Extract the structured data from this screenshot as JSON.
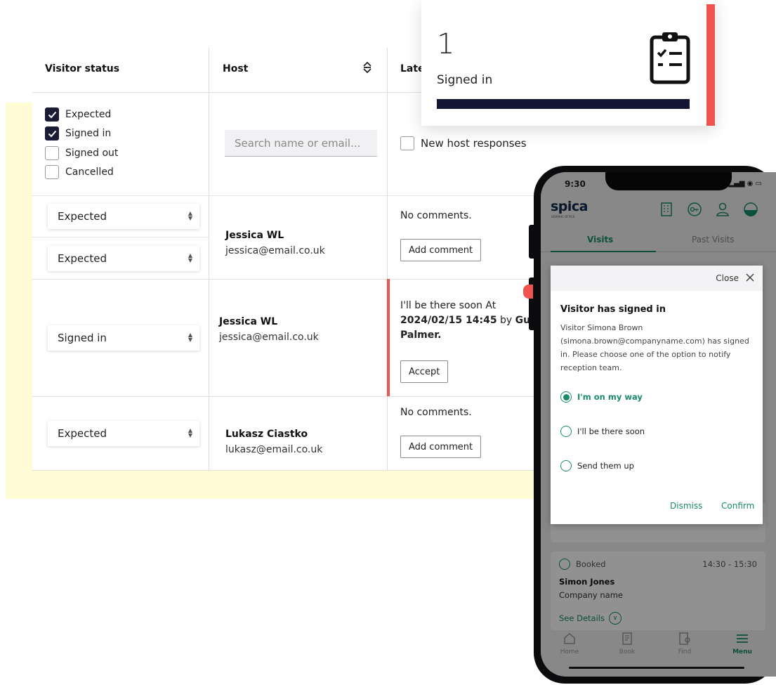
{
  "table": {
    "headers": {
      "status": "Visitor status",
      "host": "Host",
      "latest": "Late"
    },
    "filters": [
      {
        "label": "Expected",
        "checked": true
      },
      {
        "label": "Signed in",
        "checked": true
      },
      {
        "label": "Signed out",
        "checked": false
      },
      {
        "label": "Cancelled",
        "checked": false
      }
    ],
    "search_placeholder": "Search name or email...",
    "new_host_label": "New host responses",
    "rows": [
      {
        "status": "Expected",
        "status2": "Expected",
        "host_name": "Jessica WL",
        "host_email": "jessica@email.co.uk",
        "comment": "No comments.",
        "action": "Add comment"
      },
      {
        "status": "Signed in",
        "host_name": "Jessica WL",
        "host_email": "jessica@email.co.uk",
        "comment_pre": "I'll be there soon At",
        "comment_date": "2024/02/15 14:45",
        "comment_by": "by",
        "comment_name1": "Guy",
        "comment_name2": "Palmer.",
        "action": "Accept"
      },
      {
        "status": "Expected",
        "host_name": "Lukasz Ciastko",
        "host_email": "lukasz@email.co.uk",
        "comment": "No comments.",
        "action": "Add comment"
      }
    ]
  },
  "card": {
    "count": "1",
    "label": "Signed in",
    "accent": "#ef5350"
  },
  "phone": {
    "time": "9:30",
    "logo": "spica",
    "logo_sub": "GRAPHIC OFFICE",
    "tabs": [
      "Visits",
      "Past Visits"
    ],
    "modal": {
      "close": "Close",
      "title": "Visitor has signed in",
      "body": "Visitor Simona Brown (simona.brown@companyname.com) has signed in. Please choose one of the option to notify reception team.",
      "options": [
        "I'm on my way",
        "I'll be there soon",
        "Send them up"
      ],
      "selected": 0,
      "dismiss": "Dismiss",
      "confirm": "Confirm"
    },
    "booking": {
      "status": "Booked",
      "time": "14:30 - 15:30",
      "name": "Simon Jones",
      "company": "Company name",
      "details": "See Details"
    },
    "nav": [
      "Home",
      "Book",
      "Find",
      "Menu"
    ],
    "accent": "#1a8a6a"
  }
}
